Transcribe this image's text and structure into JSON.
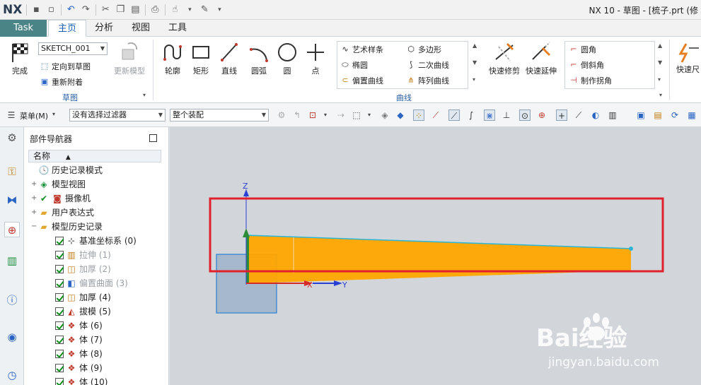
{
  "titlebar": {
    "logo": "NX",
    "window_title": "NX 10 - 草图 - [梳子.prt  (修"
  },
  "tabs": {
    "task": "Task",
    "items": [
      "主页",
      "分析",
      "视图",
      "工具"
    ],
    "active": "主页"
  },
  "ribbon": {
    "sketch_group": {
      "finish_label": "完成",
      "sketch_name": "SKETCH_001",
      "orient_label": "定向到草图",
      "reattach_label": "重新附着",
      "update_model_label": "更新模型",
      "group_label": "草图"
    },
    "curve_group": {
      "profile_label": "轮廓",
      "rectangle_label": "矩形",
      "line_label": "直线",
      "arc_label": "圆弧",
      "circle_label": "圆",
      "point_label": "点",
      "gallery": [
        "艺术样条",
        "多边形",
        "椭圆",
        "二次曲线",
        "偏置曲线",
        "阵列曲线"
      ],
      "quick_trim_label": "快速修剪",
      "quick_extend_label": "快速延伸",
      "fillet_list": [
        "圆角",
        "倒斜角",
        "制作拐角"
      ],
      "group_label": "曲线",
      "quick_dim_label": "快速尺"
    }
  },
  "selection_toolbar": {
    "menu_label": "菜单(M)",
    "filter_value": "没有选择过滤器",
    "scope_value": "整个装配"
  },
  "navigator": {
    "title": "部件导航器",
    "column_header": "名称",
    "rows": [
      {
        "label": "历史记录模式",
        "icon": "clock-icon"
      },
      {
        "label": "模型视图",
        "icon": "model-views-icon"
      },
      {
        "label": "摄像机",
        "icon": "camera-icon"
      },
      {
        "label": "用户表达式",
        "icon": "folder-icon"
      },
      {
        "label": "模型历史记录",
        "icon": "folder-open-icon"
      },
      {
        "label": "基准坐标系 (0)",
        "icon": "datum-csys-icon"
      },
      {
        "label": "拉伸 (1)",
        "icon": "extrude-icon"
      },
      {
        "label": "加厚 (2)",
        "icon": "thicken-icon"
      },
      {
        "label": "偏置曲面 (3)",
        "icon": "offset-surface-icon"
      },
      {
        "label": "加厚 (4)",
        "icon": "thicken-icon"
      },
      {
        "label": "拔模 (5)",
        "icon": "draft-icon"
      },
      {
        "label": "体 (6)",
        "icon": "body-icon"
      },
      {
        "label": "体 (7)",
        "icon": "body-icon"
      },
      {
        "label": "体 (8)",
        "icon": "body-icon"
      },
      {
        "label": "体 (9)",
        "icon": "body-icon"
      },
      {
        "label": "体 (10)",
        "icon": "body-icon"
      }
    ]
  },
  "graphics": {
    "axis_z": "Z",
    "axis_x": "X",
    "axis_y": "Y",
    "highlight_color": "#e0202a",
    "part_color": "#ffa500"
  },
  "watermark": {
    "brand": "Bai经验",
    "url": "jingyan.baidu.com"
  }
}
